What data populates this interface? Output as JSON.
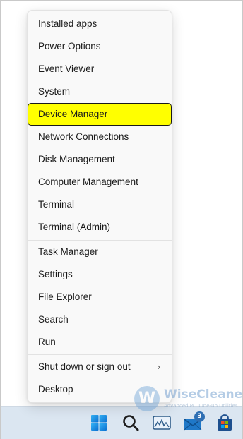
{
  "menu": {
    "items": [
      {
        "label": "Installed apps"
      },
      {
        "label": "Power Options"
      },
      {
        "label": "Event Viewer"
      },
      {
        "label": "System"
      },
      {
        "label": "Device Manager"
      },
      {
        "label": "Network Connections"
      },
      {
        "label": "Disk Management"
      },
      {
        "label": "Computer Management"
      },
      {
        "label": "Terminal"
      },
      {
        "label": "Terminal (Admin)"
      },
      {
        "label": "Task Manager"
      },
      {
        "label": "Settings"
      },
      {
        "label": "File Explorer"
      },
      {
        "label": "Search"
      },
      {
        "label": "Run"
      },
      {
        "label": "Shut down or sign out"
      },
      {
        "label": "Desktop"
      }
    ],
    "highlighted_item": "Device Manager",
    "highlight_color": "#ffff00"
  },
  "taskbar": {
    "icons": [
      "windows-start-icon",
      "search-icon",
      "photos-icon",
      "mail-icon",
      "microsoft-store-icon"
    ],
    "mail_badge": "3",
    "background": "#dbe6f1"
  },
  "watermark": {
    "logo_letter": "W",
    "name": "WiseCleaner",
    "tagline": "Advanced PC Tune-up Utilities"
  }
}
